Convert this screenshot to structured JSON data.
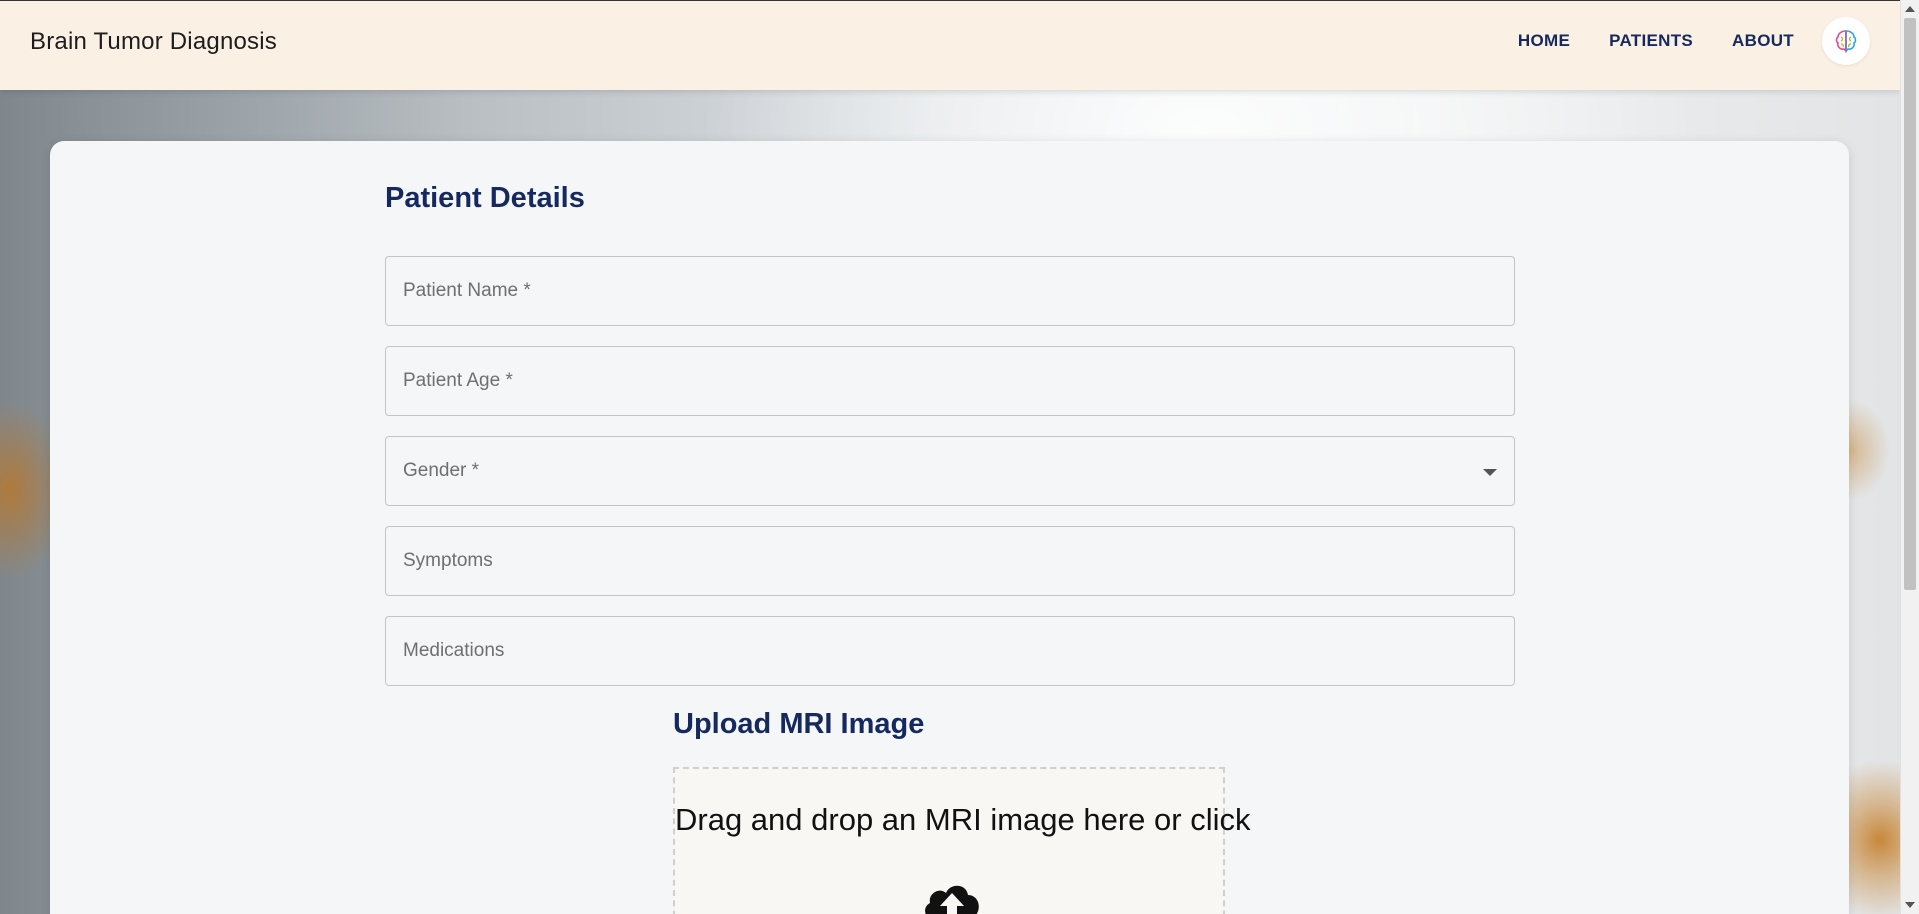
{
  "header": {
    "brand": "Brain Tumor Diagnosis",
    "nav": [
      "HOME",
      "PATIENTS",
      "ABOUT"
    ],
    "logo_icon": "brain-icon"
  },
  "form": {
    "title": "Patient Details",
    "fields": {
      "name_placeholder": "Patient Name *",
      "age_placeholder": "Patient Age *",
      "gender_label": "Gender *",
      "symptoms_placeholder": "Symptoms",
      "medications_placeholder": "Medications"
    }
  },
  "upload": {
    "title": "Upload MRI Image",
    "dropzone_text": "Drag and drop an MRI image here or click",
    "icon": "cloud-upload-icon"
  },
  "colors": {
    "header_bg": "#faf0e4",
    "accent": "#15295e",
    "card_bg": "#f4f6f8"
  }
}
